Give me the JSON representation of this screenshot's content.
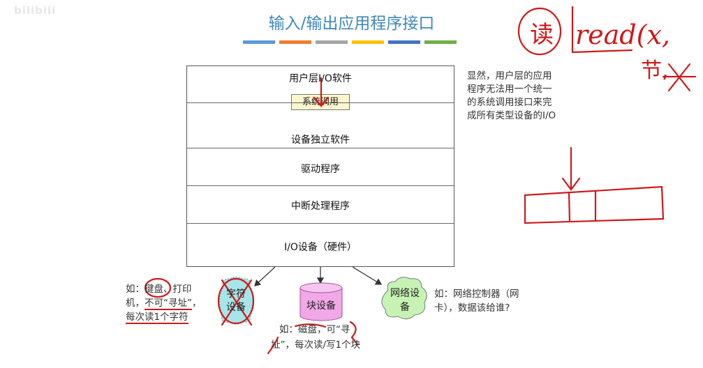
{
  "watermark": "bilibili",
  "title": "输入/输出应用程序接口",
  "title_bar_colors": [
    "#5b9bd5",
    "#ed7d31",
    "#a5a5a5",
    "#ffc000",
    "#4472c4",
    "#70ad47"
  ],
  "layers": {
    "user_io": "用户层I/O软件",
    "syscall": "系统调用",
    "device_independent": "设备独立软件",
    "driver": "驱动程序",
    "interrupt": "中断处理程序",
    "io_device": "I/O设备（硬件）"
  },
  "side_note": [
    "显然，用户层的应用",
    "程序无法用一个统一",
    "的系统调用接口来完",
    "成所有类型设备的I/O"
  ],
  "devices": {
    "char_device": "字符设备",
    "block_device": "块设备",
    "network_device": "网络设备"
  },
  "char_note": {
    "prefix": "如：",
    "keyboard": "键盘",
    "after_keyboard": "、打印",
    "line2_prefix": "机，",
    "not_addressable": "不可“寻址”",
    "line2_suffix": "，",
    "line3": "每次读1个字符"
  },
  "block_note": {
    "prefix": "如：",
    "disk": "磁盘",
    "after_disk": "，可“寻",
    "line2_lead": "址”",
    "line2_rest": "，每次读/写1个块"
  },
  "net_note": [
    "如：网络控制器（网",
    "卡），数据该给谁?"
  ],
  "handwriting": {
    "du": "读",
    "read_call": "read(x,  ",
    "line2": "节,"
  },
  "colors": {
    "title": "#3f88b9",
    "ink": "#d01818",
    "syscall_fill": "#fcf7cd",
    "block_fill": "#f0a8e6",
    "char_fill": "#a6e6ea",
    "net_fill": "#c6f3b3"
  }
}
